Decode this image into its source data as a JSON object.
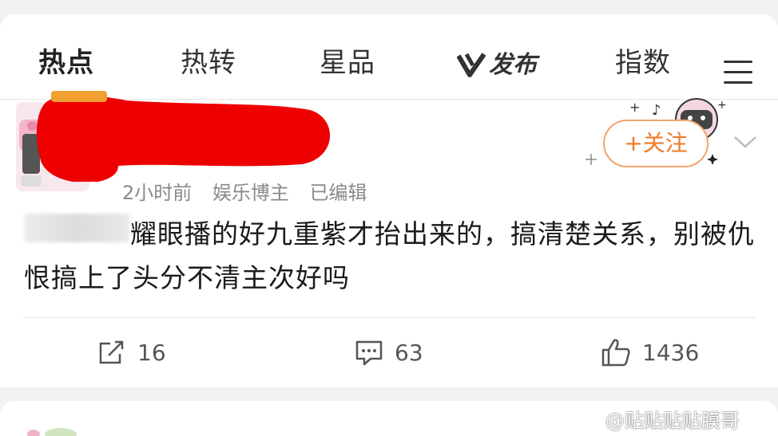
{
  "tabs": [
    {
      "label": "热点",
      "active": true
    },
    {
      "label": "热转",
      "active": false
    },
    {
      "label": "星品",
      "active": false
    },
    {
      "label": "发布",
      "active": false
    },
    {
      "label": "指数",
      "active": false
    }
  ],
  "post": {
    "meta": {
      "time": "2小时前",
      "category": "娱乐博主",
      "edited": "已编辑"
    },
    "follow_label": "+关注",
    "text": "耀眼播的好九重紫才抬出来的，搞清楚关系，别被仇恨搞上了头分不清主次好吗",
    "actions": {
      "repost_count": "16",
      "comment_count": "63",
      "like_count": "1436"
    }
  },
  "watermark": "@贴贴贴贴膜哥",
  "colors": {
    "accent": "#ef7a27",
    "redaction": "#ee0000"
  }
}
